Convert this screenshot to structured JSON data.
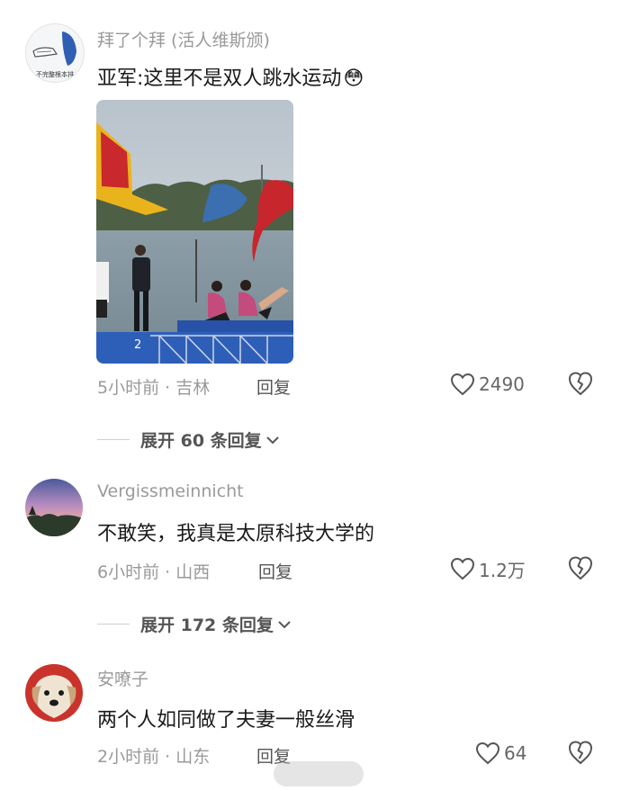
{
  "comments": [
    {
      "username": "拜了个拜 (活人维斯颁)",
      "text": "亚军:这里不是双人跳水运动",
      "emoji": "😳",
      "time_location": "5小时前 · 吉林",
      "reply_label": "回复",
      "likes": "2490",
      "expand_label": "展开 60 条回复",
      "avatar_text": "不完整根本排",
      "photo_number": "2"
    },
    {
      "username": "Vergissmeinnicht",
      "text": "不敢笑，我真是太原科技大学的",
      "time_location": "6小时前 · 山西",
      "reply_label": "回复",
      "likes": "1.2万",
      "expand_label": "展开 172 条回复"
    },
    {
      "username": "安嘹子",
      "text": "两个人如同做了夫妻一般丝滑",
      "time_location": "2小时前 · 山东",
      "reply_label": "回复",
      "likes": "64"
    }
  ],
  "colors": {
    "meta": "#9a9a9a",
    "text": "#1a1a1a",
    "action": "#555555"
  },
  "icons": {
    "like": "heart-outline-icon",
    "dislike": "broken-heart-icon",
    "expand": "chevron-down-icon"
  }
}
